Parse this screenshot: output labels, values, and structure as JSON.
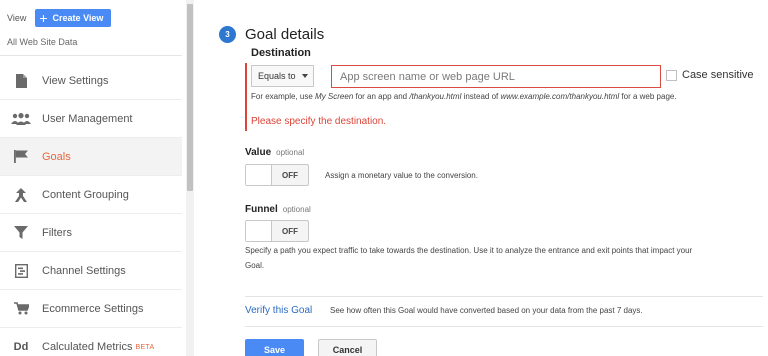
{
  "sidebar": {
    "view_label": "View",
    "create_view_label": "Create View",
    "property_name": "All Web Site Data",
    "items": [
      {
        "label": "View Settings",
        "icon": "document-icon"
      },
      {
        "label": "User Management",
        "icon": "users-icon"
      },
      {
        "label": "Goals",
        "icon": "flag-icon",
        "active": true
      },
      {
        "label": "Content Grouping",
        "icon": "grouping-icon"
      },
      {
        "label": "Filters",
        "icon": "filter-icon"
      },
      {
        "label": "Channel Settings",
        "icon": "channel-icon"
      },
      {
        "label": "Ecommerce Settings",
        "icon": "cart-icon"
      },
      {
        "label": "Calculated Metrics",
        "icon": "dd-icon",
        "icon_text": "Dd",
        "badge": "BETA"
      }
    ]
  },
  "goal_details": {
    "step_number": "3",
    "title": "Goal details",
    "destination": {
      "label": "Destination",
      "match_type": "Equals to",
      "placeholder": "App screen name or web page URL",
      "value": "",
      "case_sensitive_label": "Case sensitive",
      "case_sensitive_checked": false,
      "example": {
        "part1": "For example, use ",
        "italic1": "My Screen",
        "part2": " for an app and ",
        "italic2": "/thankyou.html",
        "part3": " instead of ",
        "italic3": "www.example.com/thankyou.html",
        "part4": " for a web page."
      },
      "error": "Please specify the destination."
    },
    "value": {
      "label": "Value",
      "optional": "optional",
      "toggle_state": "OFF",
      "hint": "Assign a monetary value to the conversion."
    },
    "funnel": {
      "label": "Funnel",
      "optional": "optional",
      "toggle_state": "OFF",
      "hint_line1": "Specify a path you expect traffic to take towards the destination. Use it to analyze the entrance and exit points that impact your",
      "hint_line2": "Goal."
    },
    "verify": {
      "link": "Verify this Goal",
      "text": "See how often this Goal would have converted based on your data from the past 7 days."
    },
    "buttons": {
      "save": "Save",
      "cancel": "Cancel"
    }
  },
  "colors": {
    "accent": "#4a8af4",
    "active_nav": "#e8663d",
    "error": "#db4437",
    "link": "#2a6bc4"
  }
}
